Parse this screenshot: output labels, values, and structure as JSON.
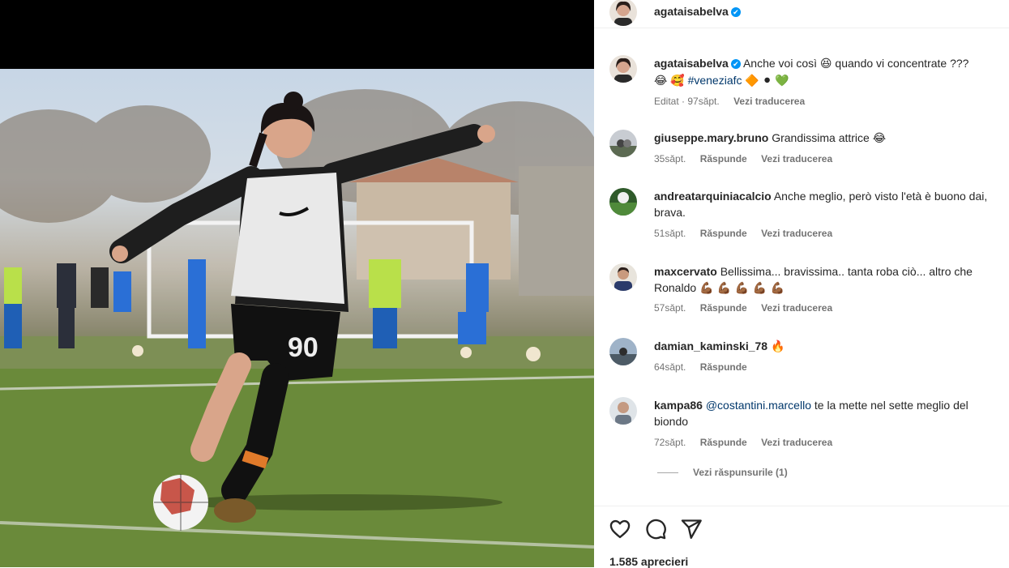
{
  "post": {
    "author": "agataisabelva",
    "verified_mark": "✔"
  },
  "caption": {
    "username": "agataisabelva",
    "text_1": "Anche voi così",
    "emoji_1": "😆",
    "text_2": "quando vi concentrate ???",
    "emoji_2": "😂",
    "emoji_3": "🥰",
    "hashtag": "#veneziafc",
    "emoji_4": "🔶",
    "emoji_5": "⚫",
    "emoji_6": "💚",
    "meta_edited": "Editat · 97săpt.",
    "meta_translate": "Vezi traducerea"
  },
  "comments": [
    {
      "username": "giuseppe.mary.bruno",
      "text": "Grandissima attrice",
      "emoji": "😂",
      "time": "35săpt.",
      "reply": "Răspunde",
      "translate": "Vezi traducerea"
    },
    {
      "username": "andreatarquiniacalcio",
      "text": "Anche meglio, però visto l'età è buono dai, brava.",
      "emoji": "",
      "time": "51săpt.",
      "reply": "Răspunde",
      "translate": "Vezi traducerea"
    },
    {
      "username": "maxcervato",
      "text": "Bellissima... bravissima.. tanta roba ciò... altro che Ronaldo",
      "emoji": "💪🏾 💪🏾 💪🏾 💪🏾 💪🏾",
      "time": "57săpt.",
      "reply": "Răspunde",
      "translate": "Vezi traducerea"
    },
    {
      "username": "damian_kaminski_78",
      "text": "",
      "emoji": "🔥",
      "time": "64săpt.",
      "reply": "Răspunde",
      "translate": ""
    },
    {
      "username": "kampa86",
      "mention": "@costantini.marcello",
      "text": "te la mette nel sette meglio del biondo",
      "emoji": "",
      "time": "72săpt.",
      "reply": "Răspunde",
      "translate": "Vezi traducerea"
    }
  ],
  "replies_toggle": "Vezi răspunsurile (1)",
  "likes": "1.585 aprecieri",
  "icons": [
    "heart-icon",
    "comment-icon",
    "share-icon"
  ],
  "colors": {
    "verified": "#0095f6",
    "meta": "#737373",
    "hashtag": "#00376b"
  }
}
